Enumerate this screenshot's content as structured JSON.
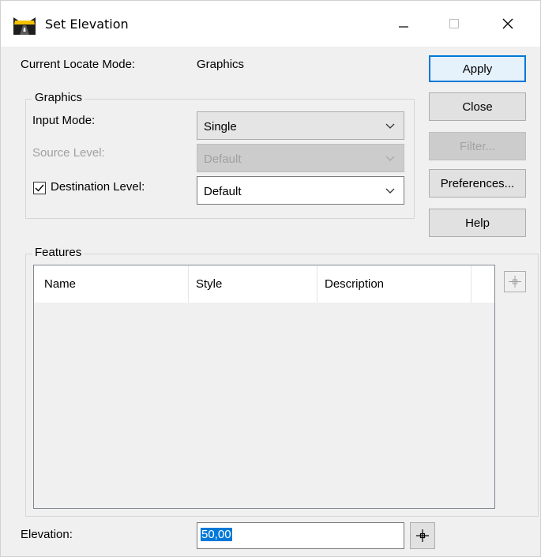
{
  "window": {
    "title": "Set Elevation",
    "app_icon": "road-icon",
    "controls": {
      "minimize": "—",
      "maximize": "☐",
      "close": "✕"
    }
  },
  "locate": {
    "label": "Current Locate Mode:",
    "value": "Graphics"
  },
  "graphics_group": {
    "legend": "Graphics",
    "input_mode": {
      "label": "Input Mode:",
      "value": "Single"
    },
    "source_level": {
      "label": "Source Level:",
      "value": "Default",
      "disabled": true
    },
    "destination_level": {
      "label": "Destination Level:",
      "value": "Default",
      "checked": true
    }
  },
  "buttons": {
    "apply": "Apply",
    "close": "Close",
    "filter": "Filter...",
    "preferences": "Preferences...",
    "help": "Help"
  },
  "features": {
    "legend": "Features",
    "columns": [
      "Name",
      "Style",
      "Description"
    ],
    "rows": []
  },
  "elevation": {
    "label": "Elevation:",
    "value": "50,00"
  },
  "icons": {
    "chevron": "chevron-down-icon",
    "pick": "crosshair-icon"
  },
  "colors": {
    "accent": "#0078d7",
    "dialog_bg": "#f0f0f0"
  }
}
